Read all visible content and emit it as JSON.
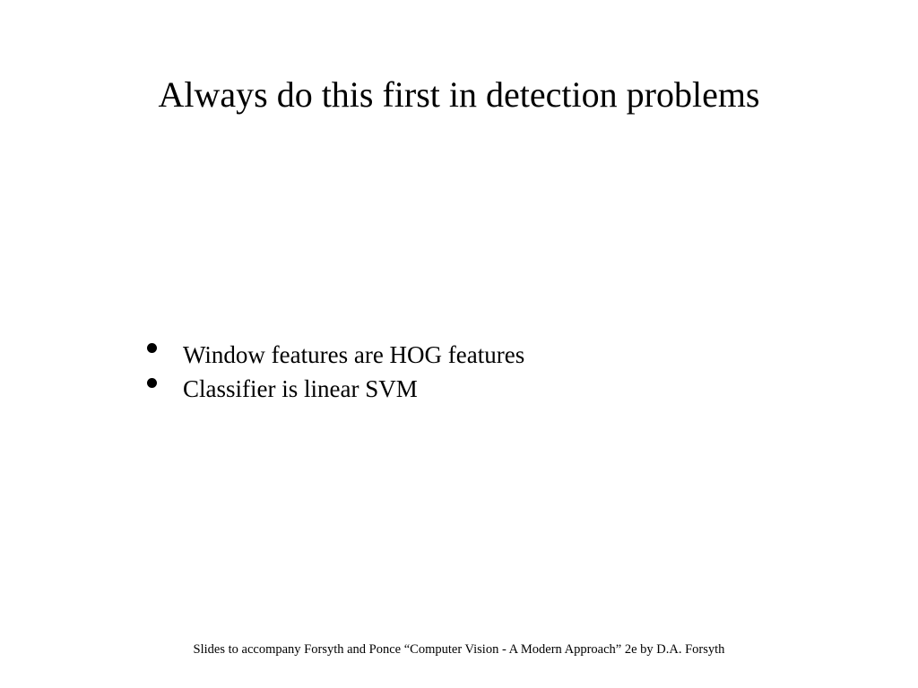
{
  "slide": {
    "title": "Always do this first in detection problems",
    "bullets": [
      "Window features are HOG features",
      "Classifier is linear SVM"
    ],
    "footer": "Slides to accompany Forsyth and Ponce “Computer Vision - A Modern Approach” 2e by D.A. Forsyth"
  }
}
